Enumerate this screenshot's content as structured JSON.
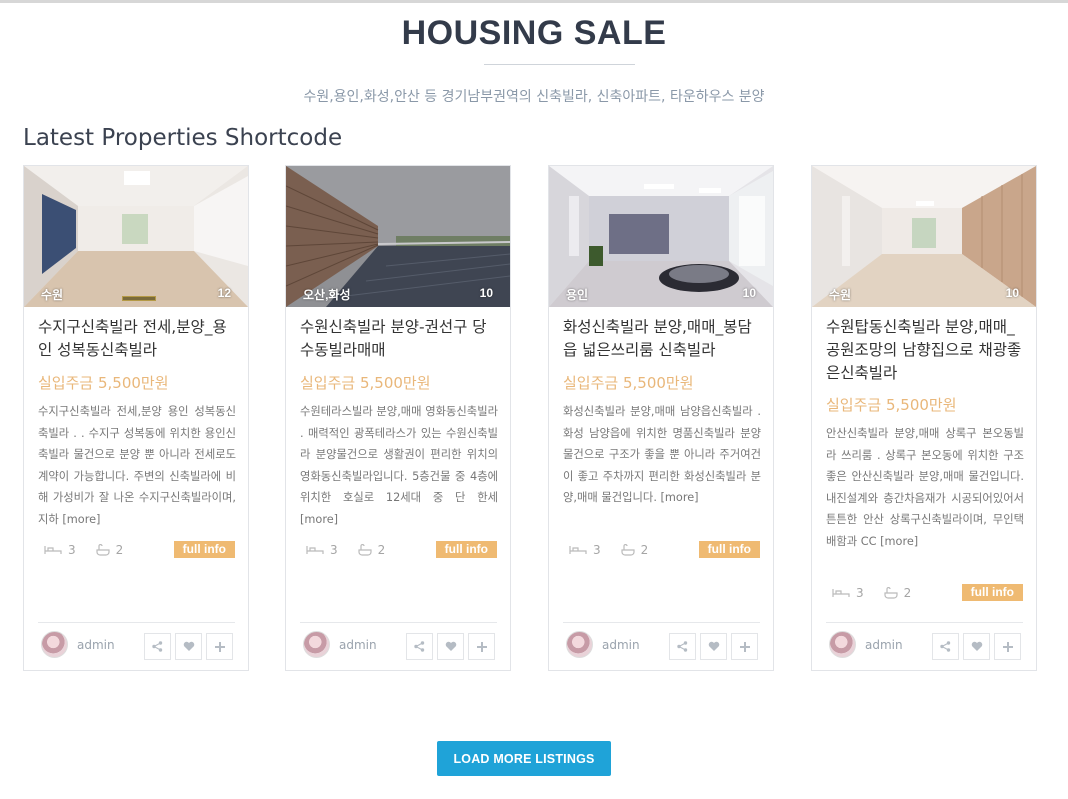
{
  "header": {
    "title": "HOUSING SALE",
    "subtitle": "수원,용인,화성,안산 등 경기남부권역의 신축빌라, 신축아파트, 타운하우스 분양"
  },
  "shortcode_heading": "Latest Properties Shortcode",
  "cards": [
    {
      "location": "수원",
      "photo_count": "12",
      "title": "수지구신축빌라 전세,분양_용인 성복동신축빌라",
      "price": "실입주금 5,500만원",
      "description": "수지구신축빌라 전세,분양 용인 성복동신축빌라 . . 수지구 성복동에 위치한 용인신축빌라 물건으로 분양 뿐 아니라 전세로도 계약이 가능합니다. 주변의 신축빌라에 비해 가성비가 잘 나온 수지구신축빌라이며, 지하",
      "more": "[more]",
      "beds": "3",
      "baths": "2",
      "full_info": "full info",
      "author": "admin"
    },
    {
      "location": "오산,화성",
      "photo_count": "10",
      "title": "수원신축빌라 분양-권선구 당수동빌라매매",
      "price": "실입주금 5,500만원",
      "description": "수원테라스빌라 분양,매매 영화동신축빌라 . 매력적인 광폭테라스가 있는 수원신축빌라 분양물건으로 생활권이 편리한 위치의 영화동신축빌라입니다. 5층건물 중 4층에 위치한 호실로 12세대 중 단 한세",
      "more": "[more]",
      "beds": "3",
      "baths": "2",
      "full_info": "full info",
      "author": "admin"
    },
    {
      "location": "용인",
      "photo_count": "10",
      "title": "화성신축빌라 분양,매매_봉담읍 넓은쓰리룸 신축빌라",
      "price": "실입주금 5,500만원",
      "description": "화성신축빌라 분양,매매 남양읍신축빌라 . 화성 남양읍에 위치한 명품신축빌라 분양물건으로 구조가 좋을 뿐 아니라 주거여건이 좋고 주차까지 편리한 화성신축빌라 분양,매매 물건입니다.",
      "more": "[more]",
      "beds": "3",
      "baths": "2",
      "full_info": "full info",
      "author": "admin"
    },
    {
      "location": "수원",
      "photo_count": "10",
      "title": "수원탑동신축빌라 분양,매매_공원조망의 남향집으로 채광좋은신축빌라",
      "price": "실입주금 5,500만원",
      "description": "안산신축빌라 분양,매매 상록구 본오동빌라 쓰리룸 . 상록구 본오동에 위치한 구조좋은 안산신축빌라 분양,매매 물건입니다. 내진설계와 층간차음재가 시공되어있어서 튼튼한 안산 상록구신축빌라이며, 무인택배함과 CC",
      "more": "[more]",
      "beds": "3",
      "baths": "2",
      "full_info": "full info",
      "author": "admin"
    }
  ],
  "load_more": "LOAD MORE LISTINGS",
  "colors": {
    "accent_blue": "#1fa3d8",
    "price_orange": "#e9b77a",
    "badge_orange": "#efba72",
    "title_dark": "#333b4a"
  },
  "icons": {
    "beds": "bed-icon",
    "baths": "bathtub-icon",
    "share": "share-icon",
    "favorite": "heart-icon",
    "add": "plus-icon"
  }
}
